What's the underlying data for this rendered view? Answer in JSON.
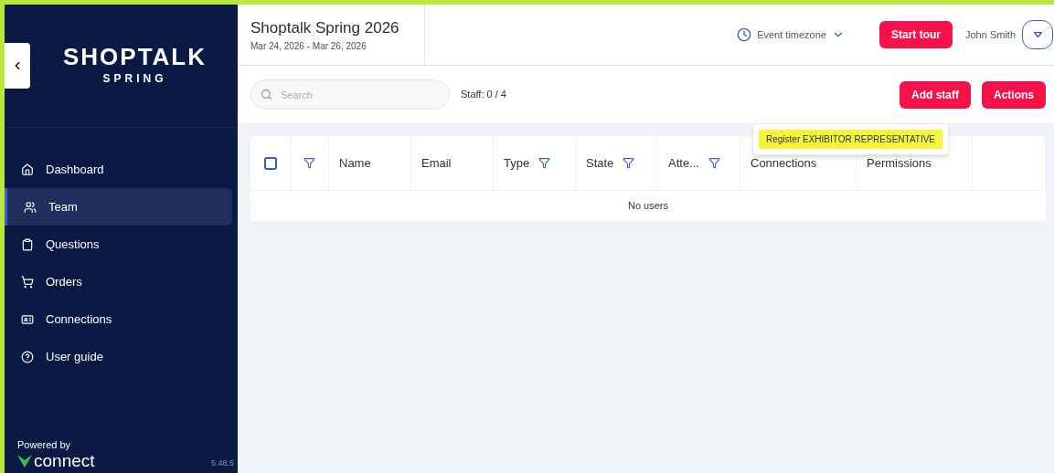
{
  "sidebar": {
    "logo": "SHOPTALK",
    "logo_sub": "SPRING",
    "items": [
      {
        "label": "Dashboard",
        "selected": false
      },
      {
        "label": "Team",
        "selected": true
      },
      {
        "label": "Questions",
        "selected": false
      },
      {
        "label": "Orders",
        "selected": false
      },
      {
        "label": "Connections",
        "selected": false
      },
      {
        "label": "User guide",
        "selected": false
      }
    ],
    "powered_by": "Powered by",
    "brand": "connect",
    "version": "5.48.5"
  },
  "header": {
    "title": "Shoptalk Spring 2026",
    "dates": "Mar 24, 2026 - Mar 26, 2026",
    "timezone": "Event timezone",
    "tour_button": "Start tour",
    "user": "John Smith"
  },
  "toolbar": {
    "search_placeholder": "Search",
    "staff_count": "Staff: 0 / 4",
    "buttons": [
      "Add staff",
      "Actions"
    ]
  },
  "dropdown": {
    "items": [
      {
        "label": "Register EXHIBITOR REPRESENTATIVE",
        "highlighted": true
      }
    ]
  },
  "table": {
    "select_all_checked": false,
    "columns": [
      {
        "kind": "filter"
      },
      {
        "kind": "text",
        "label": "Name"
      },
      {
        "kind": "text",
        "label": "Email"
      },
      {
        "kind": "filtered",
        "label": "Type"
      },
      {
        "kind": "filtered",
        "label": "State"
      },
      {
        "kind": "filtered",
        "label": "Atte..."
      },
      {
        "kind": "text",
        "label": "Connections"
      },
      {
        "kind": "text",
        "label": "Permissions"
      },
      {
        "kind": "empty"
      }
    ],
    "empty_message": "No users"
  }
}
